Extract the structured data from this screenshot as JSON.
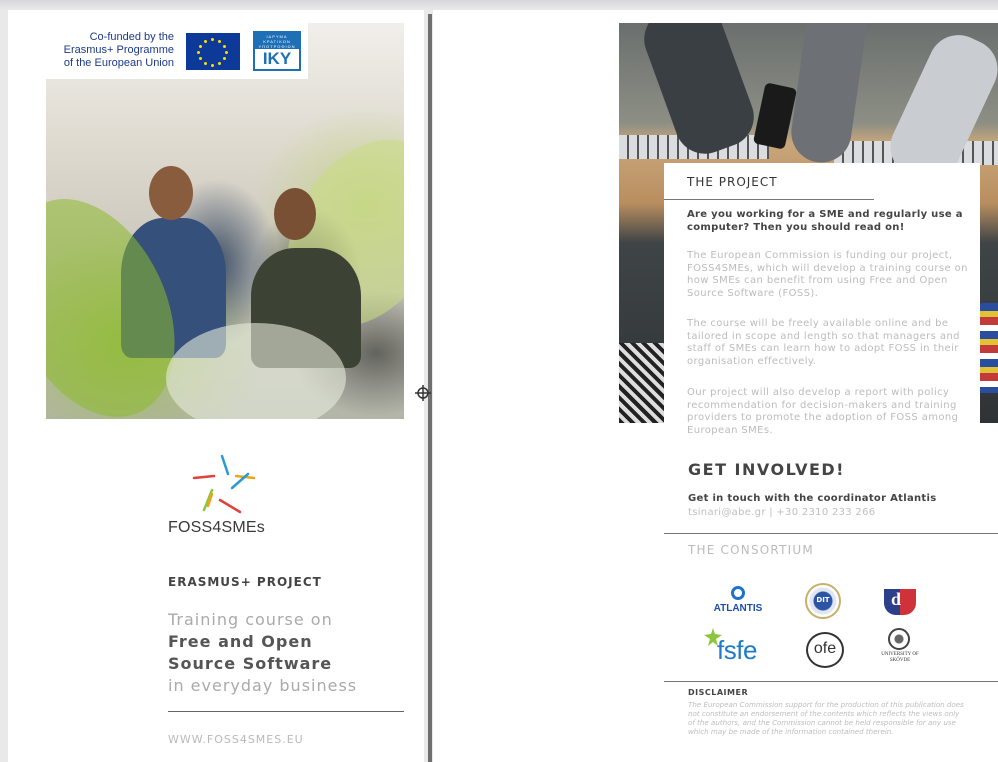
{
  "cover": {
    "funding_text": "Co-funded by the Erasmus+ Programme of the European Union",
    "funding_lines": [
      "Co-funded by the",
      "Erasmus+ Programme",
      "of the European Union"
    ],
    "iky_small": "ΙΔΡΥΜΑ ΚΡΑΤΙΚΩΝ ΥΠΟΤΡΟΦΙΩΝ",
    "iky_logo": "IKY",
    "brand_name": "FOSS4SMEs",
    "project_label": "ERASMUS+ PROJECT",
    "tagline": {
      "line1": "Training course on",
      "line2": "Free and Open",
      "line3": "Source Software",
      "line4": "in everyday business"
    },
    "website": "WWW.FOSS4SMES.EU"
  },
  "project": {
    "title": "THE PROJECT",
    "lead": "Are you working for a SME and regularly use a computer? Then you should read on!",
    "paragraphs": [
      "The European Commission is funding our project, FOSS4SMEs, which will develop a training course on how SMEs can benefit from using Free and Open Source Software (FOSS).",
      "The course will be freely available online and be tailored in scope and length so that managers and staff of SMEs can learn how to adopt FOSS in their organisation effectively.",
      "Our project will also develop a report with policy recommendation for decision-makers and training providers to promote the adoption of FOSS among European SMEs."
    ]
  },
  "involved": {
    "title": "GET INVOLVED!",
    "contact_label": "Get in touch with the coordinator Atlantis",
    "contact_info": "tsinari@abe.gr | +30 2310 233 266"
  },
  "consortium": {
    "title": "THE CONSORTIUM",
    "atlantis": "ATLANTIS",
    "dit": "DIT",
    "shield_letter": "d",
    "fsfe": "fsfe",
    "ofe": "ofe",
    "skovde": "UNIVERSITY OF SKÖVDE"
  },
  "disclaimer": {
    "title": "DISCLAIMER",
    "text": "The European Commission support for the production of this publication does not constitute an endorsement of the contents which reflects the views only of the authors, and the Commission cannot be held responsible for any use which may be made of the information contained therein."
  },
  "colors": {
    "eu_blue": "#0d3a99",
    "eu_star": "#ffdd00",
    "iky_blue": "#1e6fb5",
    "atlantis_blue": "#1d4fa8",
    "fsfe_blue": "#1f7bc8",
    "text_dark": "#444444",
    "text_muted": "#bcbcbc"
  },
  "icons": [
    "eu-flag-icon",
    "star-logo-icon",
    "crosshair-icon",
    "atlantis-icon",
    "fsfe-star-icon"
  ]
}
